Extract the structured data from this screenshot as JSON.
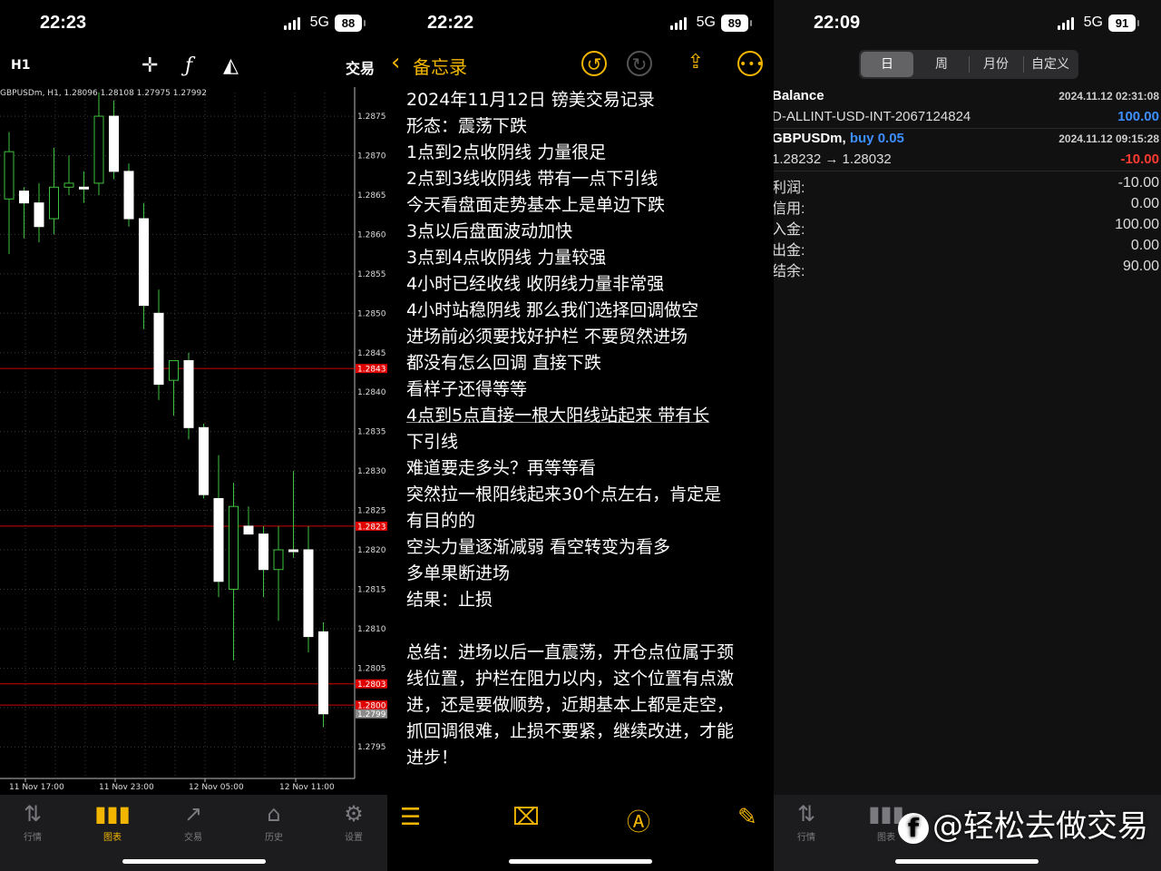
{
  "left": {
    "status": {
      "time": "22:23",
      "network": "5G",
      "battery": "88"
    },
    "toolbar": {
      "timeframe": "H1",
      "crosshair_icon": "crosshair-icon",
      "indicator_icon": "function-icon",
      "objects_icon": "shapes-icon",
      "trade_label": "交易"
    },
    "chart_info": "GBPUSDm, H1, 1.28096 1.28108 1.27975 1.27992",
    "chart_data": {
      "type": "candlestick",
      "title": "GBPUSDm, H1",
      "y_ticks": [
        "1.2875",
        "1.2870",
        "1.2865",
        "1.2860",
        "1.2855",
        "1.2850",
        "1.2845",
        "1.2840",
        "1.2835",
        "1.2830",
        "1.2825",
        "1.2820",
        "1.2815",
        "1.2810",
        "1.2805",
        "1.2800",
        "1.2795"
      ],
      "ylim": [
        1.2791,
        1.2878
      ],
      "x_ticks": [
        "11 Nov 17:00",
        "11 Nov 23:00",
        "12 Nov 05:00",
        "12 Nov 11:00"
      ],
      "price_labels": [
        {
          "text": "1.2843",
          "value": 1.2843,
          "color": "#e00000"
        },
        {
          "text": "1.2823",
          "value": 1.2823,
          "color": "#e00000"
        },
        {
          "text": "1.2803",
          "value": 1.2803,
          "color": "#e00000"
        },
        {
          "text": "1.2800",
          "value": 1.28003,
          "color": "#e00000"
        },
        {
          "text": "1.2799",
          "value": 1.27992,
          "color": "#8a8a8a"
        }
      ],
      "candles": [
        {
          "o": 1.28645,
          "h": 1.2873,
          "l": 1.28575,
          "c": 1.28705
        },
        {
          "o": 1.28655,
          "h": 1.2866,
          "l": 1.28595,
          "c": 1.2864
        },
        {
          "o": 1.2864,
          "h": 1.28665,
          "l": 1.2859,
          "c": 1.2861
        },
        {
          "o": 1.2862,
          "h": 1.2871,
          "l": 1.286,
          "c": 1.2866
        },
        {
          "o": 1.2866,
          "h": 1.287,
          "l": 1.2865,
          "c": 1.28665
        },
        {
          "o": 1.2866,
          "h": 1.2868,
          "l": 1.2864,
          "c": 1.2866
        },
        {
          "o": 1.28665,
          "h": 1.2878,
          "l": 1.2865,
          "c": 1.2875
        },
        {
          "o": 1.2875,
          "h": 1.2877,
          "l": 1.2867,
          "c": 1.2868
        },
        {
          "o": 1.2868,
          "h": 1.2869,
          "l": 1.2861,
          "c": 1.2862
        },
        {
          "o": 1.2862,
          "h": 1.2864,
          "l": 1.2848,
          "c": 1.2851
        },
        {
          "o": 1.285,
          "h": 1.2853,
          "l": 1.2839,
          "c": 1.2841
        },
        {
          "o": 1.28415,
          "h": 1.2844,
          "l": 1.2837,
          "c": 1.2844
        },
        {
          "o": 1.2844,
          "h": 1.2845,
          "l": 1.2834,
          "c": 1.28355
        },
        {
          "o": 1.28355,
          "h": 1.2836,
          "l": 1.28265,
          "c": 1.2827
        },
        {
          "o": 1.28265,
          "h": 1.2832,
          "l": 1.2814,
          "c": 1.2816
        },
        {
          "o": 1.2815,
          "h": 1.28285,
          "l": 1.2806,
          "c": 1.28255
        },
        {
          "o": 1.2823,
          "h": 1.28255,
          "l": 1.2822,
          "c": 1.2822
        },
        {
          "o": 1.2822,
          "h": 1.2823,
          "l": 1.2814,
          "c": 1.28175
        },
        {
          "o": 1.28175,
          "h": 1.2823,
          "l": 1.2811,
          "c": 1.282
        },
        {
          "o": 1.282,
          "h": 1.283,
          "l": 1.2819,
          "c": 1.282
        },
        {
          "o": 1.282,
          "h": 1.2823,
          "l": 1.2807,
          "c": 1.2809
        },
        {
          "o": 1.28096,
          "h": 1.28108,
          "l": 1.27975,
          "c": 1.27992
        }
      ]
    },
    "nav": [
      {
        "label": "行情",
        "icon": "quotes-icon"
      },
      {
        "label": "图表",
        "icon": "chart-icon"
      },
      {
        "label": "交易",
        "icon": "trade-icon"
      },
      {
        "label": "历史",
        "icon": "history-icon"
      },
      {
        "label": "设置",
        "icon": "settings-icon"
      }
    ]
  },
  "middle": {
    "status": {
      "time": "22:22",
      "network": "5G",
      "battery": "89"
    },
    "header": {
      "back_label": "备忘录"
    },
    "note_lines": [
      "2024年11月12日 镑美交易记录",
      "形态：震荡下跌",
      "1点到2点收阴线 力量很足",
      "2点到3线收阴线 带有一点下引线",
      "今天看盘面走势基本上是单边下跌",
      "3点以后盘面波动加快",
      "3点到4点收阴线 力量较强",
      "4小时已经收线 收阴线力量非常强",
      "4小时站稳阴线 那么我们选择回调做空",
      "进场前必须要找好护栏 不要贸然进场",
      "都没有怎么回调 直接下跌",
      "看样子还得等等",
      "4点到5点直接一根大阳线站起来 带有长",
      "下引线",
      "难道要走多头？再等等看",
      "突然拉一根阳线起来30个点左右，肯定是",
      "有目的的",
      "空头力量逐渐减弱 看空转变为看多",
      "多单果断进场",
      "结果：止损",
      "",
      "总结：进场以后一直震荡，开仓点位属于颈",
      "线位置，护栏在阻力以内，这个位置有点激",
      "进，还是要做顺势，近期基本上都是走空，",
      "抓回调很难，止损不要紧，继续改进，才能",
      "进步！"
    ]
  },
  "right": {
    "status": {
      "time": "22:09",
      "network": "5G",
      "battery": "91"
    },
    "tabs": [
      "日",
      "周",
      "月份",
      "自定义"
    ],
    "balance": {
      "title": "Balance",
      "time": "2024.11.12 02:31:08",
      "id": "D-ALLINT-USD-INT-2067124824",
      "amount": "100.00"
    },
    "deal": {
      "symbol": "GBPUSDm,",
      "side": "buy 0.05",
      "time": "2024.11.12 09:15:28",
      "prices": "1.28232 → 1.28032",
      "profit": "-10.00"
    },
    "summary": [
      {
        "label": "利润:",
        "value": "-10.00"
      },
      {
        "label": "信用:",
        "value": "0.00"
      },
      {
        "label": "入金:",
        "value": "100.00"
      },
      {
        "label": "出金:",
        "value": "0.00"
      },
      {
        "label": "结余:",
        "value": "90.00"
      }
    ],
    "nav": [
      {
        "label": "行情",
        "icon": "quotes-icon"
      },
      {
        "label": "图表",
        "icon": "chart-icon"
      }
    ],
    "watermark": "@轻松去做交易"
  }
}
